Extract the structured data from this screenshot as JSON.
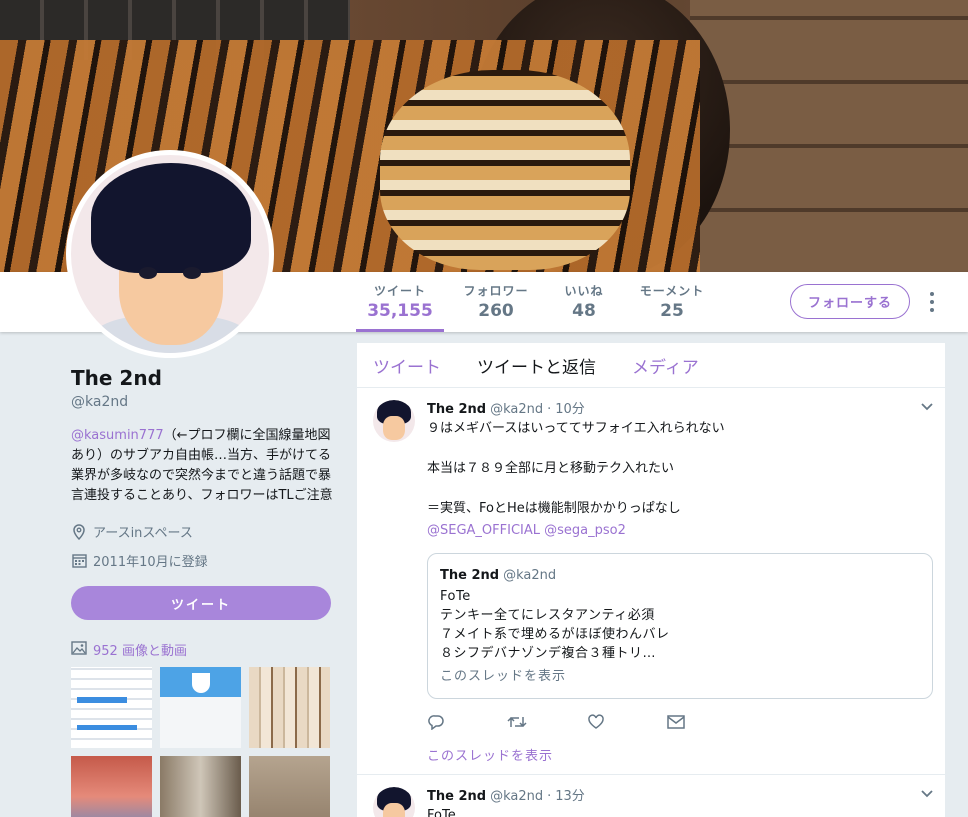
{
  "profile": {
    "name": "The 2nd",
    "handle": "@ka2nd",
    "bio_mention": "@kasumin777",
    "bio_text": "（←プロフ欄に全国線量地図あり）のサブアカ自由帳…当方、手がけてる業界が多岐なので突然今までと違う話題で暴言連投することあり、フォロワーはTLご注意",
    "location": "アースinスペース",
    "joined": "2011年10月に登録",
    "tweet_button": "ツイート",
    "media_link": "952 画像と動画"
  },
  "nav": {
    "stats": [
      {
        "label": "ツイート",
        "value": "35,155",
        "active": true
      },
      {
        "label": "フォロワー",
        "value": "260",
        "active": false
      },
      {
        "label": "いいね",
        "value": "48",
        "active": false
      },
      {
        "label": "モーメント",
        "value": "25",
        "active": false
      }
    ],
    "follow_button": "フォローする"
  },
  "timeline": {
    "tabs": [
      "ツイート",
      "ツイートと返信",
      "メディア"
    ],
    "active_tab": "ツイートと返信",
    "tweets": [
      {
        "name": "The 2nd",
        "handle": "@ka2nd",
        "separator": "·",
        "time": "10分",
        "text": "９はメギバースはいっててサフォイエ入れられない\n\n本当は７８９全部に月と移動テク入れたい\n\n＝実質、FoとHeは機能制限かかりっぱなし",
        "mentions": "@SEGA_OFFICIAL @sega_pso2",
        "quote": {
          "name": "The 2nd",
          "handle": "@ka2nd",
          "lines": [
            "FoTe",
            "テンキー全てにレスタアンティ必須",
            "７メイト系で埋めるがほぼ使わんバレ",
            "８シフデバナゾンデ複合３種トリ…"
          ],
          "link": "このスレッドを表示"
        },
        "thread_link": "このスレッドを表示"
      },
      {
        "name": "The 2nd",
        "handle": "@ka2nd",
        "separator": "·",
        "time": "13分",
        "text": "FoTe"
      }
    ]
  },
  "colors": {
    "accent": "#9a72d1",
    "button_fill": "#a886db",
    "background": "#e6ecf0",
    "muted": "#657786"
  }
}
